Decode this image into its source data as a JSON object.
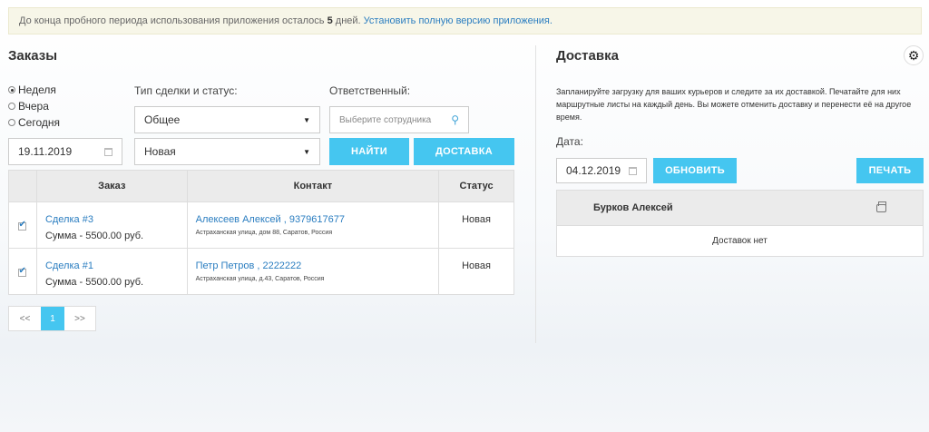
{
  "trial": {
    "text_before": "До конца пробного периода использования приложения осталось",
    "days": "5",
    "text_after": "дней.",
    "link": "Установить полную версию приложения."
  },
  "orders": {
    "title": "Заказы",
    "periods": [
      {
        "label": "Неделя",
        "selected": true
      },
      {
        "label": "Вчера",
        "selected": false
      },
      {
        "label": "Сегодня",
        "selected": false
      }
    ],
    "date_value": "19.11.2019",
    "deal_type_label": "Тип сделки и статус:",
    "deal_type_value": "Общее",
    "status_value": "Новая",
    "responsible_label": "Ответственный:",
    "responsible_placeholder": "Выберите сотрудника",
    "find_button": "НАЙТИ",
    "delivery_button": "ДОСТАВКА",
    "columns": [
      "Заказ",
      "Контакт",
      "Статус"
    ],
    "rows": [
      {
        "deal": "Сделка #3",
        "sum": "Сумма - 5500.00 руб.",
        "contact": "Алексеев Алексей , 9379617677",
        "address": "Астраханская улица, дом 88, Саратов, Россия",
        "status": "Новая"
      },
      {
        "deal": "Сделка #1",
        "sum": "Сумма - 5500.00 руб.",
        "contact": "Петр Петров , 2222222",
        "address": "Астраханская улица, д.43, Саратов, Россия",
        "status": "Новая"
      }
    ],
    "pager": {
      "prev": "<<",
      "page": "1",
      "next": ">>"
    }
  },
  "delivery": {
    "title": "Доставка",
    "description": "Запланируйте загрузку для ваших курьеров и следите за их доставкой. Печатайте для них маршрутные листы на каждый день. Вы можете отменить доставку и перенести её на другое время.",
    "date_label": "Дата:",
    "date_value": "04.12.2019",
    "refresh_button": "ОБНОВИТЬ",
    "print_button": "ПЕЧАТЬ",
    "courier": "Бурков Алексей",
    "empty_text": "Доставок нет"
  },
  "colors": {
    "accent": "#45c6f0",
    "link": "#2a7dc0"
  }
}
